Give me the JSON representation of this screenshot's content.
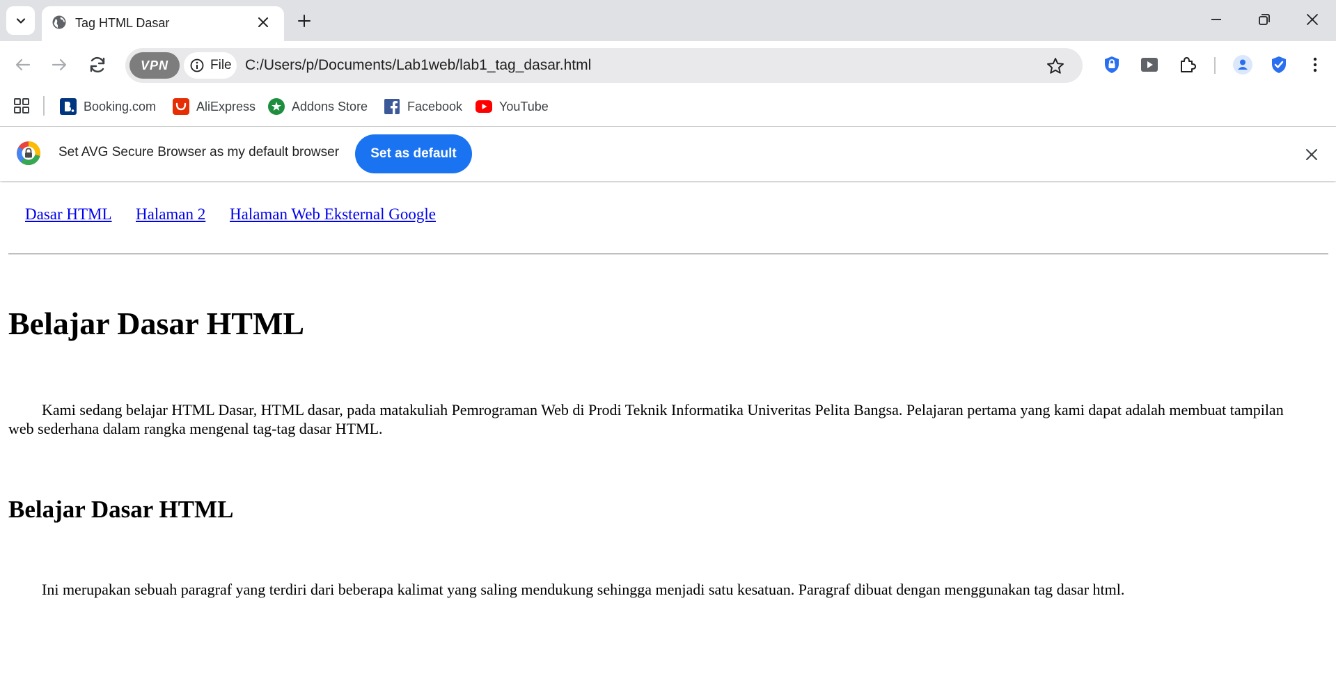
{
  "browser": {
    "tab": {
      "title": "Tag HTML Dasar"
    },
    "address": {
      "vpn_label": "VPN",
      "scheme_label": "File",
      "url": "C:/Users/p/Documents/Lab1web/lab1_tag_dasar.html"
    },
    "bookmarks": [
      {
        "label": "Booking.com",
        "icon": "booking-icon",
        "color": "#003580"
      },
      {
        "label": "AliExpress",
        "icon": "aliexpress-icon",
        "color": "#e62e04"
      },
      {
        "label": "Addons Store",
        "icon": "addons-store-icon",
        "color": "#1e8e3e"
      },
      {
        "label": "Facebook",
        "icon": "facebook-icon",
        "color": "#1877f2"
      },
      {
        "label": "YouTube",
        "icon": "youtube-icon",
        "color": "#ff0000"
      }
    ],
    "infobar": {
      "message": "Set AVG Secure Browser as my default browser",
      "button_label": "Set as default",
      "accent": "#1a73f0"
    }
  },
  "page": {
    "nav_links": [
      "Dasar HTML",
      "Halaman 2",
      "Halaman Web Eksternal Google"
    ],
    "heading1": "Belajar Dasar HTML",
    "paragraph1": "Kami sedang belajar HTML Dasar, HTML dasar, pada matakuliah Pemrograman Web di Prodi Teknik Informatika Univeritas Pelita Bangsa. Pelajaran pertama yang kami dapat adalah membuat tampilan web sederhana dalam rangka mengenal tag-tag dasar HTML.",
    "heading2": "Belajar Dasar HTML",
    "paragraph2": "Ini merupakan sebuah paragraf yang terdiri dari beberapa kalimat yang saling mendukung sehingga menjadi satu kesatuan. Paragraf dibuat dengan menggunakan tag dasar html.",
    "link_color": "#0000ee"
  }
}
